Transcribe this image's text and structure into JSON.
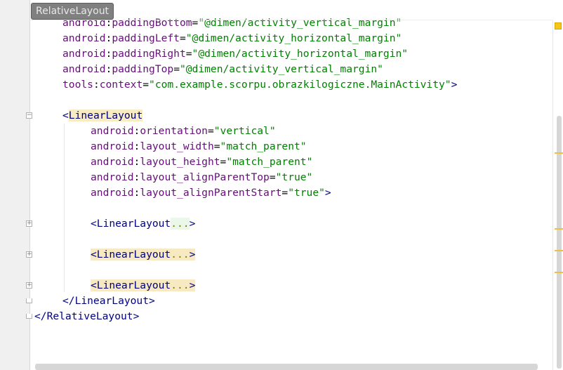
{
  "breadcrumb": {
    "label": "RelativeLayout"
  },
  "code_lines": [
    {
      "segments": [
        {
          "cls": "ns",
          "text": "android"
        },
        {
          "cls": "",
          "text": ":"
        },
        {
          "cls": "attr",
          "text": "paddingBottom"
        },
        {
          "cls": "",
          "text": "="
        },
        {
          "cls": "val",
          "text": "\"@dimen/activity_vertical_margin\""
        }
      ]
    },
    {
      "segments": [
        {
          "cls": "ns",
          "text": "android"
        },
        {
          "cls": "",
          "text": ":"
        },
        {
          "cls": "attr",
          "text": "paddingLeft"
        },
        {
          "cls": "",
          "text": "="
        },
        {
          "cls": "val",
          "text": "\"@dimen/activity_horizontal_margin\""
        }
      ]
    },
    {
      "segments": [
        {
          "cls": "ns",
          "text": "android"
        },
        {
          "cls": "",
          "text": ":"
        },
        {
          "cls": "attr",
          "text": "paddingRight"
        },
        {
          "cls": "",
          "text": "="
        },
        {
          "cls": "val",
          "text": "\"@dimen/activity_horizontal_margin\""
        }
      ]
    },
    {
      "segments": [
        {
          "cls": "ns",
          "text": "android"
        },
        {
          "cls": "",
          "text": ":"
        },
        {
          "cls": "attr",
          "text": "paddingTop"
        },
        {
          "cls": "",
          "text": "="
        },
        {
          "cls": "val",
          "text": "\"@dimen/activity_vertical_margin\""
        }
      ]
    },
    {
      "segments": [
        {
          "cls": "ns",
          "text": "tools"
        },
        {
          "cls": "",
          "text": ":"
        },
        {
          "cls": "attr",
          "text": "context"
        },
        {
          "cls": "",
          "text": "="
        },
        {
          "cls": "val",
          "text": "\"com.example.scorpu.obrazkilogiczne.MainActivity\""
        },
        {
          "cls": "tag",
          "text": ">"
        }
      ]
    },
    {
      "segments": []
    },
    {
      "segments": [
        {
          "cls": "tag",
          "text": "<"
        },
        {
          "cls": "tag tag-hl",
          "text": "LinearLayout"
        }
      ]
    },
    {
      "segments": [
        {
          "cls": "ns",
          "text": "android"
        },
        {
          "cls": "",
          "text": ":"
        },
        {
          "cls": "attr",
          "text": "orientation"
        },
        {
          "cls": "",
          "text": "="
        },
        {
          "cls": "val",
          "text": "\"vertical\""
        }
      ]
    },
    {
      "segments": [
        {
          "cls": "ns",
          "text": "android"
        },
        {
          "cls": "",
          "text": ":"
        },
        {
          "cls": "attr",
          "text": "layout_width"
        },
        {
          "cls": "",
          "text": "="
        },
        {
          "cls": "val",
          "text": "\"match_parent\""
        }
      ]
    },
    {
      "segments": [
        {
          "cls": "ns",
          "text": "android"
        },
        {
          "cls": "",
          "text": ":"
        },
        {
          "cls": "attr",
          "text": "layout_height"
        },
        {
          "cls": "",
          "text": "="
        },
        {
          "cls": "val",
          "text": "\"match_parent\""
        }
      ]
    },
    {
      "segments": [
        {
          "cls": "ns",
          "text": "android"
        },
        {
          "cls": "",
          "text": ":"
        },
        {
          "cls": "attr",
          "text": "layout_alignParentTop"
        },
        {
          "cls": "",
          "text": "="
        },
        {
          "cls": "val",
          "text": "\"true\""
        }
      ]
    },
    {
      "segments": [
        {
          "cls": "ns",
          "text": "android"
        },
        {
          "cls": "",
          "text": ":"
        },
        {
          "cls": "attr",
          "text": "layout_alignParentStart"
        },
        {
          "cls": "",
          "text": "="
        },
        {
          "cls": "val",
          "text": "\"true\""
        },
        {
          "cls": "tag",
          "text": ">"
        }
      ]
    },
    {
      "segments": []
    },
    {
      "segments": [
        {
          "cls": "tag",
          "text": "<LinearLayout"
        },
        {
          "cls": "folded",
          "text": "..."
        },
        {
          "cls": "tag",
          "text": ">"
        }
      ]
    },
    {
      "segments": []
    },
    {
      "segments": [
        {
          "cls": "tag folded-hl",
          "text": "<LinearLayout"
        },
        {
          "cls": "ellipsis folded-hl",
          "text": "..."
        },
        {
          "cls": "tag folded-hl",
          "text": ">"
        }
      ]
    },
    {
      "segments": []
    },
    {
      "segments": [
        {
          "cls": "tag folded-hl",
          "text": "<LinearLayout"
        },
        {
          "cls": "ellipsis folded-hl",
          "text": "..."
        },
        {
          "cls": "tag folded-hl",
          "text": ">"
        }
      ]
    },
    {
      "segments": [
        {
          "cls": "tag",
          "text": "</LinearLayout>"
        }
      ]
    },
    {
      "segments": [
        {
          "cls": "tag",
          "text": "</RelativeLayout>"
        }
      ]
    }
  ],
  "colors": {
    "attribute": "#660e7a",
    "value": "#008000",
    "tag": "#000080",
    "highlight": "#f7ecc2"
  }
}
